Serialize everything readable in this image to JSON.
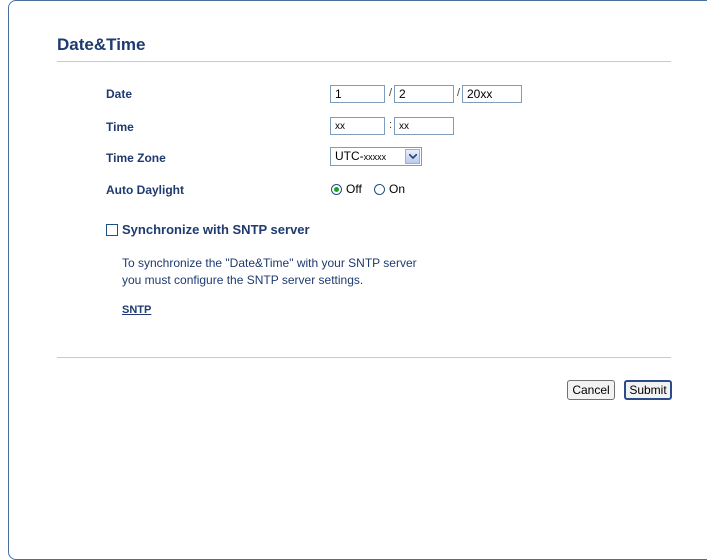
{
  "page": {
    "title": "Date&Time"
  },
  "date": {
    "label": "Date",
    "day": "1",
    "month": "2",
    "year": "20xx",
    "separator": "/"
  },
  "time": {
    "label": "Time",
    "hour": "xx",
    "minute": "xx",
    "separator": ":"
  },
  "timezone": {
    "label": "Time Zone",
    "prefix": "UTC-",
    "suffix": "xxxxx"
  },
  "daylight": {
    "label": "Auto Daylight",
    "off_label": "Off",
    "on_label": "On",
    "selected": "Off"
  },
  "sntp": {
    "checkbox_label": "Synchronize with SNTP server",
    "checked": false,
    "desc_line1": "To synchronize the \"Date&Time\" with your SNTP server",
    "desc_line2": "you must configure the SNTP server settings.",
    "link": "SNTP"
  },
  "buttons": {
    "cancel": "Cancel",
    "submit": "Submit"
  },
  "colors": {
    "heading": "#1e3a70",
    "border": "#4a6f9f",
    "radio_selected": "#21a121"
  }
}
